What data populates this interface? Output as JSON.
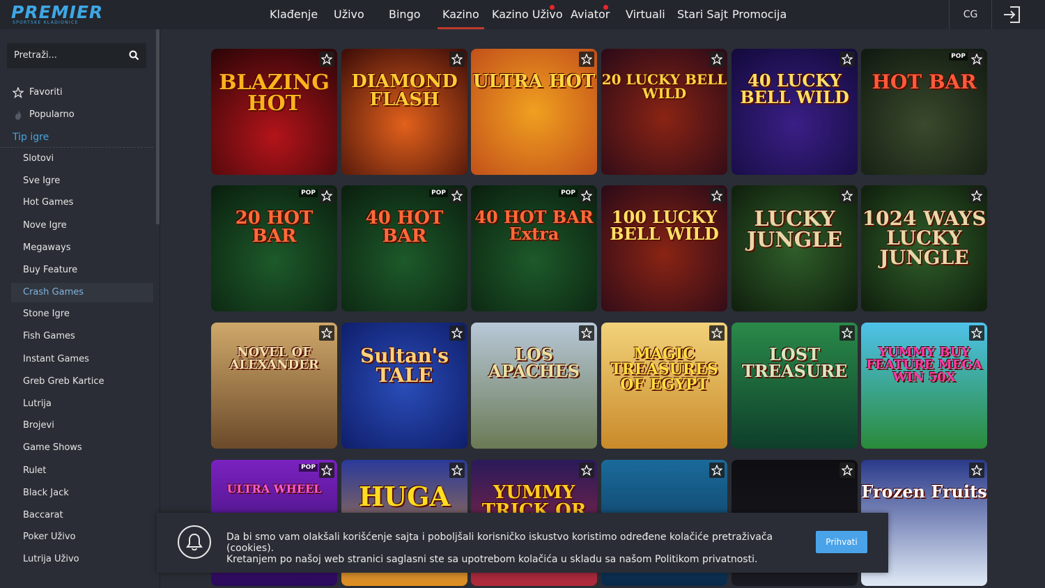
{
  "brand": {
    "name": "PREMIER",
    "tagline": "SPORTSKE KLADIONICE"
  },
  "nav": {
    "items": [
      {
        "label": "Klađenje",
        "badge": false
      },
      {
        "label": "Uživo",
        "badge": false
      },
      {
        "label": "Bingo",
        "badge": false
      },
      {
        "label": "Kazino",
        "badge": false,
        "active": true
      },
      {
        "label": "Kazino Uživo",
        "badge": true
      },
      {
        "label": "Aviator",
        "badge": true
      },
      {
        "label": "Virtuali",
        "badge": false
      },
      {
        "label": "Stari Sajt",
        "badge": false
      },
      {
        "label": "Promocija",
        "badge": false
      }
    ],
    "language": "CG",
    "login_icon": "login-icon"
  },
  "sidebar": {
    "search_placeholder": "Pretraži...",
    "links": [
      {
        "label": "Favoriti",
        "icon": "star-icon"
      },
      {
        "label": "Popularno",
        "icon": "fire-icon"
      }
    ],
    "section_title": "Tip igre",
    "categories": [
      "Slotovi",
      "Sve Igre",
      "Hot Games",
      "Nove Igre",
      "Megaways",
      "Buy Feature",
      "Crash Games",
      "Stone Igre",
      "Fish Games",
      "Instant Games",
      "Greb Greb Kartice",
      "Lutrija",
      "Brojevi",
      "Game Shows",
      "Rulet",
      "Black Jack",
      "Baccarat",
      "Poker Uživo",
      "Lutrija Uživo"
    ],
    "active_category": "Crash Games"
  },
  "games": [
    {
      "title": "BLAZING HOT",
      "badge": ""
    },
    {
      "title": "DIAMOND FLASH",
      "badge": ""
    },
    {
      "title": "ULTRA HOT",
      "badge": ""
    },
    {
      "title": "20 LUCKY BELL WILD",
      "badge": ""
    },
    {
      "title": "40 LUCKY BELL WILD",
      "badge": ""
    },
    {
      "title": "HOT BAR",
      "badge": "POP"
    },
    {
      "title": "20 HOT BAR",
      "badge": "POP"
    },
    {
      "title": "40 HOT BAR",
      "badge": "POP"
    },
    {
      "title": "40 HOT BAR Extra",
      "badge": "POP"
    },
    {
      "title": "100 LUCKY BELL WILD",
      "badge": ""
    },
    {
      "title": "LUCKY JUNGLE",
      "badge": ""
    },
    {
      "title": "1024 WAYS LUCKY JUNGLE",
      "badge": ""
    },
    {
      "title": "NOVEL OF ALEXANDER",
      "badge": ""
    },
    {
      "title": "Sultan's TALE",
      "badge": ""
    },
    {
      "title": "LOS APACHES",
      "badge": ""
    },
    {
      "title": "MAGIC TREASURES OF EGYPT",
      "badge": ""
    },
    {
      "title": "LOST TREASURE",
      "badge": ""
    },
    {
      "title": "YUMMY BUY FEATURE MEGA WIN 50X",
      "badge": ""
    },
    {
      "title": "ULTRA WHEEL",
      "badge": "POP"
    },
    {
      "title": "HUGA",
      "badge": ""
    },
    {
      "title": "YUMMY TRICK OR TREAT",
      "badge": ""
    },
    {
      "title": "",
      "badge": ""
    },
    {
      "title": "",
      "badge": ""
    },
    {
      "title": "Frozen Fruits",
      "badge": ""
    }
  ],
  "cookie": {
    "line1": "Da bi smo vam olakšali korišćenje sajta i poboljšali korisničko iskustvo koristimo određene kolačiće pretraživača (cookies).",
    "line2": "Kretanjem po našoj web stranici saglasni ste sa upotrebom kolačića u skladu sa našom Politikom privatnosti.",
    "button": "Prihvati"
  },
  "colors": {
    "accent": "#4aa3df",
    "active_nav_underline": "#c0392b",
    "badge_dot": "#e5262c",
    "button": "#4aa3e8"
  }
}
